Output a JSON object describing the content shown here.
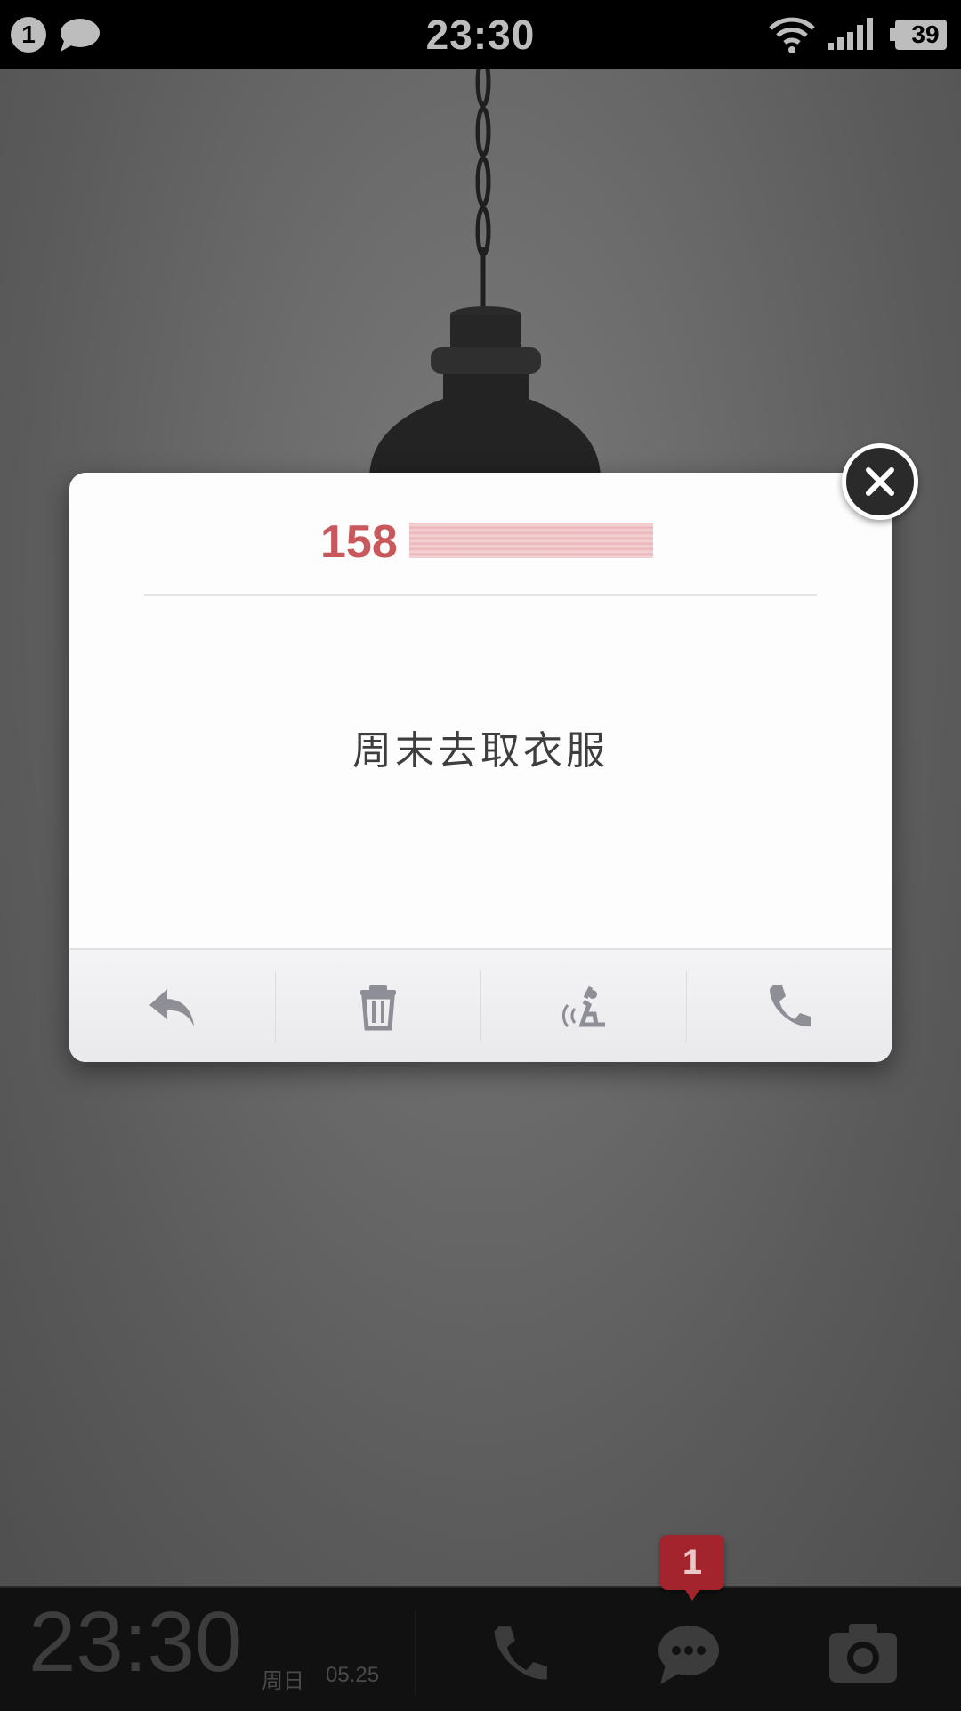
{
  "status_bar": {
    "notification_count": "1",
    "time": "23:30",
    "battery": "39",
    "icons": [
      "notification-badge-icon",
      "chat-icon",
      "wifi-icon",
      "signal-icon",
      "battery-icon"
    ]
  },
  "dialog": {
    "sender_prefix": "158",
    "message": "周末去取衣服",
    "actions": [
      {
        "name": "reply",
        "icon": "reply-icon"
      },
      {
        "name": "delete",
        "icon": "trash-icon"
      },
      {
        "name": "read-aloud",
        "icon": "speak-icon"
      },
      {
        "name": "call",
        "icon": "phone-icon"
      }
    ],
    "close_icon": "close-icon"
  },
  "bottom_bar": {
    "time": "23:30",
    "weekday": "周日",
    "date": "05.25",
    "message_badge": "1",
    "icons": [
      "phone-icon",
      "message-icon",
      "camera-icon"
    ]
  },
  "colors": {
    "accent_red": "#c8585c",
    "badge_red": "#a3242c",
    "status_bar_bg": "#000000",
    "bottom_bar_bg": "#111111"
  }
}
